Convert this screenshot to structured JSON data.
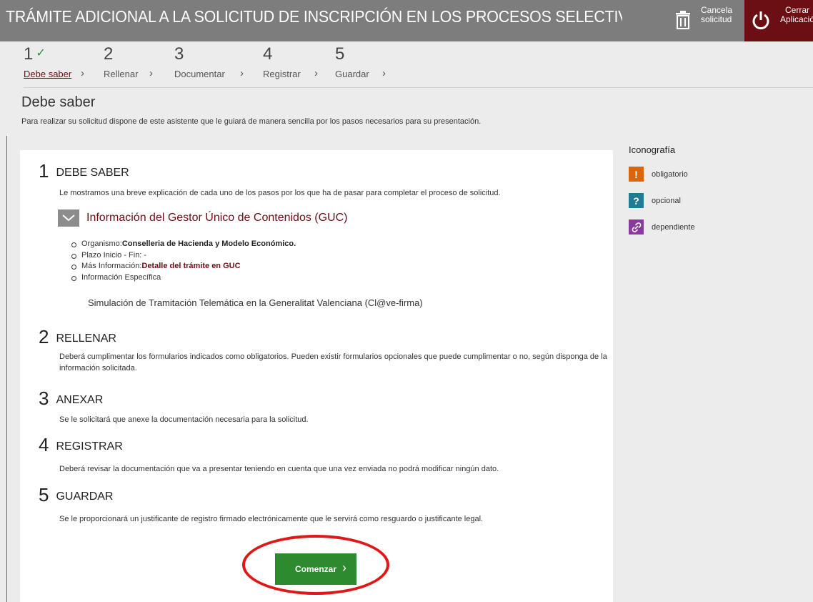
{
  "header": {
    "title": "TRÁMITE ADICIONAL A LA SOLICITUD DE INSCRIPCIÓN EN LOS PROCESOS SELECTIVOS A CUERPOS DOCE",
    "cancel_line1": "Cancela",
    "cancel_line2": "solicitud",
    "close_line1": "Cerrar",
    "close_line2": "Aplicación",
    "cancel_icon": "trash-icon",
    "close_icon": "power-icon",
    "accent_color": "#6b0f14"
  },
  "steps": [
    {
      "number": "1",
      "check": "✓",
      "label": "Debe saber",
      "active": true
    },
    {
      "number": "2",
      "label": "Rellenar"
    },
    {
      "number": "3",
      "label": "Documentar"
    },
    {
      "number": "4",
      "label": "Registrar"
    },
    {
      "number": "5",
      "label": "Guardar"
    }
  ],
  "page": {
    "title": "Debe saber",
    "subtitle": "Para realizar su solicitud dispone de este asistente que le guiará de manera sencilla por los pasos necesarios para su presentación."
  },
  "main": {
    "s1_num": "1",
    "s1_title": "DEBE SABER",
    "s1_text": "Le mostramos una breve explicación de cada uno de los pasos por los que ha de pasar para completar el proceso de solicitud.",
    "accordion_title": "Información del Gestor Único de Contenidos (GUC)",
    "info": {
      "organismo_label": "Organismo:",
      "organismo_value": "Conselleria de Hacienda y Modelo Económico.",
      "plazo": "Plazo Inicio - Fin: -",
      "mas_label": "Más Información:",
      "mas_link": "Detalle del trámite en GUC",
      "especifica": "Información Específica"
    },
    "sim_text": "Simulación de Tramitación Telemática en la Generalitat Valenciana (Cl@ve-firma)",
    "s2_num": "2",
    "s2_title": "RELLENAR",
    "s2_text": "Deberá cumplimentar los formularios indicados como obligatorios. Pueden existir formularios opcionales que puede cumplimentar o no, según disponga de la información solicitada.",
    "s3_num": "3",
    "s3_title": "ANEXAR",
    "s3_text": "Se le solicitará que anexe la documentación necesaria para la solicitud.",
    "s4_num": "4",
    "s4_title": "REGISTRAR",
    "s4_text": "Deberá revisar la documentación que va a presentar teniendo en cuenta que una vez enviada no podrá modificar ningún dato.",
    "s5_num": "5",
    "s5_title": "GUARDAR",
    "s5_text": "Se le proporcionará un justificante de registro firmado electrónicamente que le servirá como resguardo o justificante legal.",
    "start_label": "Comenzar",
    "start_arrow": "›"
  },
  "iconografia": {
    "title": "Iconografía",
    "items": [
      {
        "symbol": "!",
        "label": "obligatorio",
        "color": "#d9660d"
      },
      {
        "symbol": "?",
        "label": "opcional",
        "color": "#1f7b96"
      },
      {
        "symbol": "🔗",
        "label": "dependiente",
        "color": "#8a3a9e"
      }
    ]
  }
}
